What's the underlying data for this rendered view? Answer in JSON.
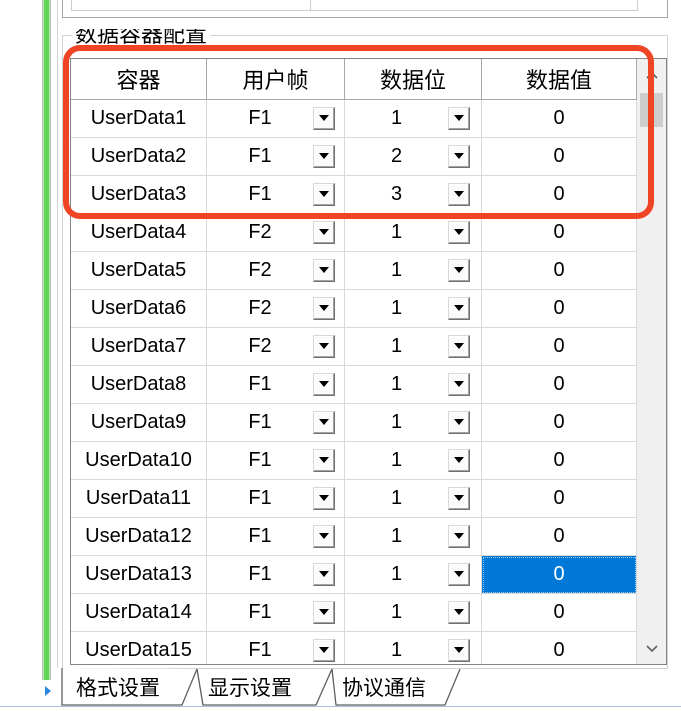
{
  "group_box": {
    "title": "数据容器配置"
  },
  "grid": {
    "headers": {
      "container": "容器",
      "frame": "用户帧",
      "bit": "数据位",
      "value": "数据值"
    },
    "rows": [
      {
        "container": "UserData1",
        "frame": "F1",
        "bit": "1",
        "value": "0"
      },
      {
        "container": "UserData2",
        "frame": "F1",
        "bit": "2",
        "value": "0"
      },
      {
        "container": "UserData3",
        "frame": "F1",
        "bit": "3",
        "value": "0"
      },
      {
        "container": "UserData4",
        "frame": "F2",
        "bit": "1",
        "value": "0"
      },
      {
        "container": "UserData5",
        "frame": "F2",
        "bit": "1",
        "value": "0"
      },
      {
        "container": "UserData6",
        "frame": "F2",
        "bit": "1",
        "value": "0"
      },
      {
        "container": "UserData7",
        "frame": "F2",
        "bit": "1",
        "value": "0"
      },
      {
        "container": "UserData8",
        "frame": "F1",
        "bit": "1",
        "value": "0"
      },
      {
        "container": "UserData9",
        "frame": "F1",
        "bit": "1",
        "value": "0"
      },
      {
        "container": "UserData10",
        "frame": "F1",
        "bit": "1",
        "value": "0"
      },
      {
        "container": "UserData11",
        "frame": "F1",
        "bit": "1",
        "value": "0"
      },
      {
        "container": "UserData12",
        "frame": "F1",
        "bit": "1",
        "value": "0"
      },
      {
        "container": "UserData13",
        "frame": "F1",
        "bit": "1",
        "value": "0",
        "value_selected": true
      },
      {
        "container": "UserData14",
        "frame": "F1",
        "bit": "1",
        "value": "0"
      },
      {
        "container": "UserData15",
        "frame": "F1",
        "bit": "1",
        "value": "0"
      }
    ],
    "scroll_position": 0
  },
  "tabs": [
    {
      "label": "格式设置",
      "active": true
    },
    {
      "label": "显示设置",
      "active": false
    },
    {
      "label": "协议通信",
      "active": false
    }
  ],
  "icons": {
    "dropdown": "dropdown-arrow-icon",
    "scroll_up": "scroll-up-chevron-icon",
    "scroll_down": "scroll-down-chevron-icon",
    "tab_nav": "tab-scroll-right-icon"
  },
  "colors": {
    "selection": "#0078d7",
    "selection_text": "#ffffff",
    "annotation": "#ef4426",
    "side_bar": "#62d356",
    "grid_line": "#d9d9d9"
  }
}
